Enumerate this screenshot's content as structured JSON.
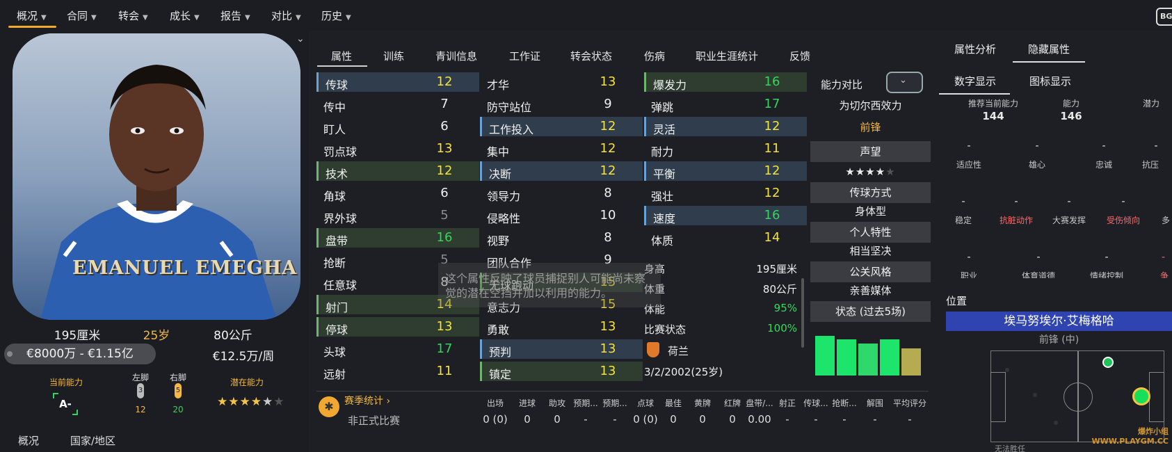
{
  "top_nav": {
    "items": [
      {
        "label": "概况"
      },
      {
        "label": "合同"
      },
      {
        "label": "转会"
      },
      {
        "label": "成长"
      },
      {
        "label": "报告"
      },
      {
        "label": "对比"
      },
      {
        "label": "历史"
      }
    ],
    "corner_badge": "BG"
  },
  "player": {
    "card_name": "EMANUEL EMEGHA",
    "height": "195厘米",
    "age": "25岁",
    "weight": "80公斤",
    "value_range": "€8000万 - €1.15亿",
    "wage": "€12.5万/周",
    "current_ability_label": "当前能力",
    "current_ability_grade": "A-",
    "left_foot_label": "左脚",
    "left_foot_value": "12",
    "left_foot_badge": "3",
    "right_foot_label": "右脚",
    "right_foot_value": "20",
    "right_foot_badge": "5",
    "potential_label": "潜在能力",
    "potential_stars": "★★★★",
    "potential_star_half": "★",
    "potential_star_empty": "★"
  },
  "left_bottom_tabs": [
    {
      "label": "概况"
    },
    {
      "label": "国家/地区"
    }
  ],
  "middle_tabs": [
    {
      "label": "属性"
    },
    {
      "label": "训练"
    },
    {
      "label": "青训信息"
    },
    {
      "label": "工作证"
    },
    {
      "label": "转会状态"
    },
    {
      "label": "伤病"
    },
    {
      "label": "职业生涯统计"
    },
    {
      "label": "反馈"
    }
  ],
  "attributes": {
    "technical": [
      {
        "label": "传球",
        "value": "12"
      },
      {
        "label": "传中",
        "value": "7"
      },
      {
        "label": "盯人",
        "value": "6"
      },
      {
        "label": "罚点球",
        "value": "13"
      },
      {
        "label": "技术",
        "value": "12"
      },
      {
        "label": "角球",
        "value": "6"
      },
      {
        "label": "界外球",
        "value": "5"
      },
      {
        "label": "盘带",
        "value": "16"
      },
      {
        "label": "抢断",
        "value": "5"
      },
      {
        "label": "任意球",
        "value": "8"
      },
      {
        "label": "射门",
        "value": "14"
      },
      {
        "label": "停球",
        "value": "13"
      },
      {
        "label": "头球",
        "value": "17"
      },
      {
        "label": "远射",
        "value": "11"
      }
    ],
    "mental": [
      {
        "label": "才华",
        "value": "13"
      },
      {
        "label": "防守站位",
        "value": "9"
      },
      {
        "label": "工作投入",
        "value": "12"
      },
      {
        "label": "集中",
        "value": "12"
      },
      {
        "label": "决断",
        "value": "12"
      },
      {
        "label": "领导力",
        "value": "8"
      },
      {
        "label": "侵略性",
        "value": "10"
      },
      {
        "label": "视野",
        "value": "8"
      },
      {
        "label": "团队合作",
        "value": "9"
      },
      {
        "label": "无球跑动",
        "value": "15"
      },
      {
        "label": "意志力",
        "value": "15"
      },
      {
        "label": "勇敢",
        "value": "13"
      },
      {
        "label": "预判",
        "value": "13"
      },
      {
        "label": "镇定",
        "value": "13"
      }
    ],
    "physical": [
      {
        "label": "爆发力",
        "value": "16"
      },
      {
        "label": "弹跳",
        "value": "17"
      },
      {
        "label": "灵活",
        "value": "12"
      },
      {
        "label": "耐力",
        "value": "11"
      },
      {
        "label": "平衡",
        "value": "12"
      },
      {
        "label": "强壮",
        "value": "12"
      },
      {
        "label": "速度",
        "value": "16"
      },
      {
        "label": "体质",
        "value": "14"
      }
    ]
  },
  "info": {
    "height_label": "身高",
    "height_value": "195厘米",
    "weight_label": "体重",
    "weight_value": "80公斤",
    "fitness_label": "体能",
    "fitness_value": "95%",
    "match_label": "比赛状态",
    "match_value": "100%",
    "nation": "荷兰",
    "dob": "3/2/2002(25岁)"
  },
  "tooltip": "这个属性反映了球员捕捉别人可能尚未察觉的潜在空挡并加以利用的能力。",
  "comparison": {
    "header": "能力对比",
    "effort_label": "为切尔西效力",
    "position": "前锋",
    "reputation_label": "声望",
    "reputation_stars": "★★★★",
    "reputation_empty": "★",
    "passing_style_label": "传球方式",
    "passing_style_value": "身体型",
    "personality_label": "个人特性",
    "personality_value": "相当坚决",
    "media_label": "公关风格",
    "media_value": "亲善媒体",
    "form_label": "状态 (过去5场)",
    "form_bars": [
      0.82,
      0.74,
      0.66,
      0.74,
      0.56
    ],
    "form_colors": [
      "#1de56c",
      "#1de56c",
      "#2fd86a",
      "#1de56c",
      "#b5ac52"
    ]
  },
  "right_panel": {
    "tabs_top": [
      {
        "label": "属性分析"
      },
      {
        "label": "隐藏属性"
      }
    ],
    "tabs_sub": [
      {
        "label": "数字显示"
      },
      {
        "label": "图标显示"
      }
    ],
    "rec_ability_label": "推荐当前能力",
    "rec_ability_value": "144",
    "ability_label": "能力",
    "ability_value": "146",
    "potential_label": "潜力",
    "row1": [
      {
        "label": "适应性"
      },
      {
        "label": "雄心"
      },
      {
        "label": "忠诚"
      },
      {
        "label": "抗压"
      }
    ],
    "row2": [
      {
        "label": "稳定"
      },
      {
        "label": "抗脏动作"
      },
      {
        "label": "大赛发挥"
      },
      {
        "label": "受伤倾向"
      },
      {
        "label": "多"
      }
    ],
    "row3": [
      {
        "label": "职业"
      },
      {
        "label": "体育道德"
      },
      {
        "label": "情绪控制"
      },
      {
        "label": "争"
      }
    ],
    "dash": "-",
    "position_header": "位置",
    "player_name_cn": "埃马努埃尔·艾梅格哈",
    "position_sub": "前锋 (中)",
    "bottom_cut_text": "无法胜任"
  },
  "season_stats": {
    "title": "赛季统计",
    "row_label": "非正式比赛",
    "headers": [
      "出场",
      "进球",
      "助攻",
      "预期...",
      "预期...",
      "点球",
      "最佳",
      "黄牌",
      "红牌",
      "盘带/...",
      "射正",
      "传球...",
      "抢断...",
      "解围",
      "平均评分"
    ],
    "values": [
      "0 (0)",
      "0",
      "0",
      "-",
      "-",
      "0 (0)",
      "0",
      "0",
      "0",
      "0.00",
      "-",
      "-",
      "-",
      "-",
      "-"
    ]
  },
  "watermark": "爆炸小组 WWW.PLAYGM.CC"
}
